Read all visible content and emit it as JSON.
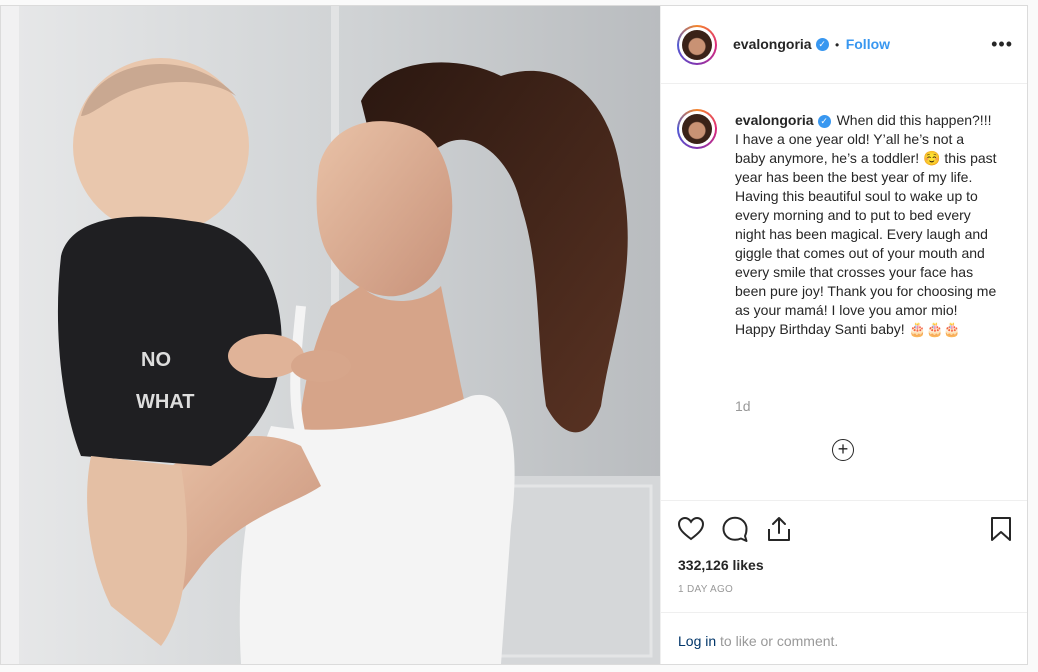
{
  "post": {
    "username": "evalongoria",
    "follow_separator": "•",
    "follow_label": "Follow",
    "options_label": "•••",
    "caption": "When did this happen?!!! I have a one year old! Y’all he’s not a baby anymore, he’s a toddler! ☺️ this past year has been the best year of my life. Having this beautiful soul to wake up to every morning and to put to bed every night has been magical. Every laugh and giggle that comes out of your mouth and every smile that crosses your face has been pure joy! Thank you for choosing me as your mamá! I love you amor mio! Happy Birthday Santi baby! 🎂🎂🎂",
    "time_ago": "1d",
    "load_more": "+",
    "likes": "332,126 likes",
    "date": "1 DAY AGO",
    "login_link": "Log in",
    "login_rest": " to like or comment.",
    "verified_mark": "✓"
  },
  "icons": [
    "heart-icon",
    "comment-icon",
    "share-icon",
    "bookmark-icon"
  ],
  "colors": {
    "link": "#3897f0",
    "verified": "#3897f0",
    "muted": "#999999",
    "login_link": "#003569"
  }
}
